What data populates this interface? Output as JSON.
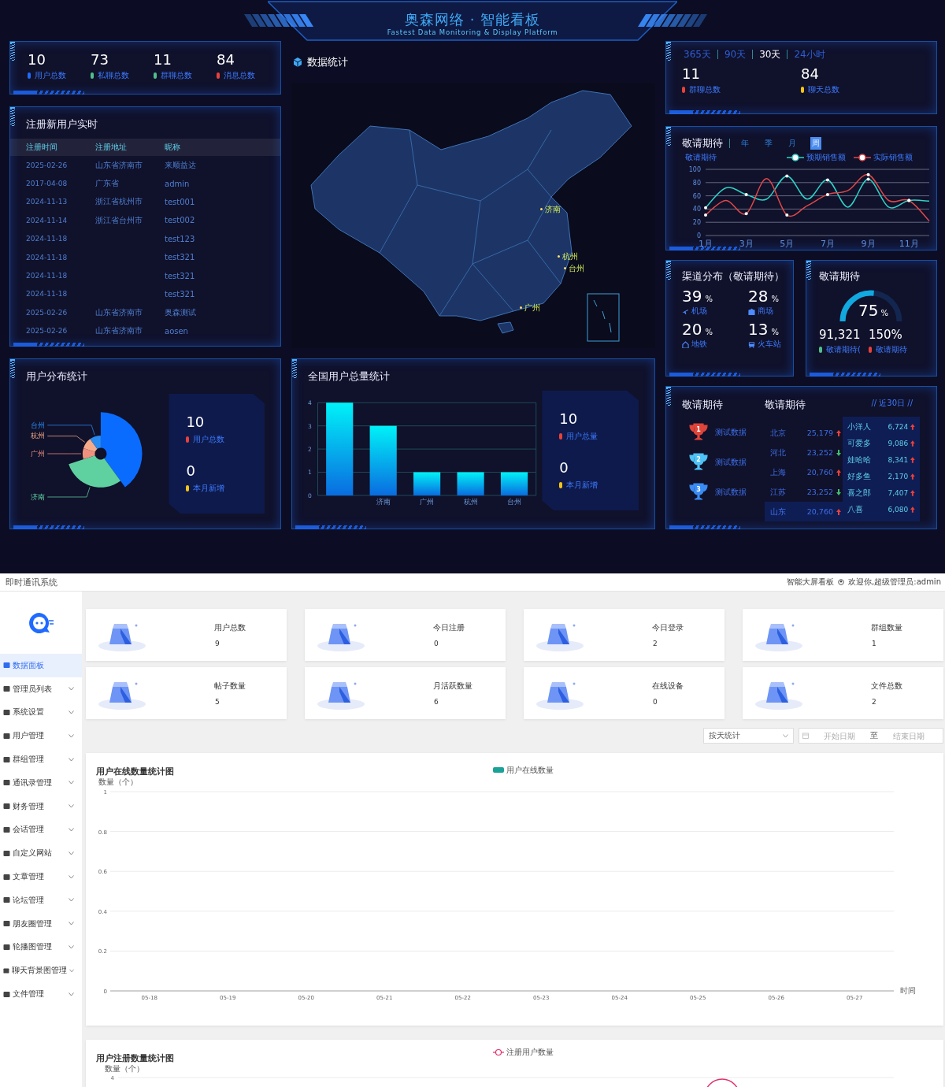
{
  "header": {
    "title": "奥森网络 · 智能看板",
    "subtitle": "Fastest Data Monitoring & Display Platform"
  },
  "totals": [
    {
      "value": "10",
      "label": "用户总数",
      "color": "#1e6cff"
    },
    {
      "value": "73",
      "label": "私聊总数",
      "color": "#4fc08d"
    },
    {
      "value": "11",
      "label": "群聊总数",
      "color": "#4fc08d"
    },
    {
      "value": "84",
      "label": "消息总数",
      "color": "#e8413c"
    }
  ],
  "new_users": {
    "title": "注册新用户实时",
    "columns": [
      "注册时间",
      "注册地址",
      "昵称"
    ],
    "rows": [
      {
        "date": "2025-02-26",
        "address": "山东省济南市",
        "nickname": "来顺益达"
      },
      {
        "date": "2017-04-08",
        "address": "广东省",
        "nickname": "admin"
      },
      {
        "date": "2024-11-13",
        "address": "浙江省杭州市",
        "nickname": "test001"
      },
      {
        "date": "2024-11-14",
        "address": "浙江省台州市",
        "nickname": "test002"
      },
      {
        "date": "2024-11-18",
        "nickname": "test123"
      },
      {
        "date": "2024-11-18",
        "nickname": "test321"
      },
      {
        "date": "2024-11-18",
        "nickname": "test321"
      },
      {
        "date": "2024-11-18",
        "nickname": "test321"
      },
      {
        "date": "2025-02-26",
        "address": "山东省济南市",
        "nickname": "奥森测试"
      },
      {
        "date": "2025-02-26",
        "address": "山东省济南市",
        "nickname": "aosen"
      }
    ]
  },
  "user_distribution": {
    "title": "用户分布统计",
    "slice_labels": [
      "台州",
      "杭州",
      "广州",
      "济南"
    ],
    "stats": [
      {
        "value": "10",
        "label": "用户总数",
        "color": "#e8413c"
      },
      {
        "value": "0",
        "label": "本月新增",
        "color": "#f5c518"
      }
    ]
  },
  "map": {
    "heading": "数据统计",
    "labels": [
      "济南",
      "杭州",
      "台州",
      "广州"
    ]
  },
  "user_totals": {
    "title": "全国用户总量统计",
    "chart_data": {
      "type": "bar",
      "categories": [
        null,
        "济南",
        "广州",
        "杭州",
        "台州"
      ],
      "values": [
        4,
        3,
        1,
        1,
        1
      ],
      "ylim": [
        0,
        4
      ],
      "yticks": [
        0,
        1,
        2,
        3,
        4
      ],
      "grid": true
    },
    "stats": [
      {
        "value": "10",
        "label": "用户总量",
        "color": "#e8413c"
      },
      {
        "value": "0",
        "label": "本月新增",
        "color": "#f5c518"
      }
    ]
  },
  "range": {
    "tabs": [
      {
        "label": "365天",
        "selected": false
      },
      {
        "label": "90天",
        "selected": false
      },
      {
        "label": "30天",
        "selected": true
      },
      {
        "label": "24小时",
        "selected": false
      }
    ],
    "stats": [
      {
        "value": "11",
        "label": "群聊总数",
        "color": "#e8413c"
      },
      {
        "value": "84",
        "label": "聊天总数",
        "color": "#f5c518"
      }
    ]
  },
  "trend": {
    "title": "敬请期待",
    "tabs": [
      {
        "label": "年",
        "selected": false
      },
      {
        "label": "季",
        "selected": false
      },
      {
        "label": "月",
        "selected": false
      },
      {
        "label": "周",
        "selected": true
      }
    ],
    "chart_data": {
      "type": "line",
      "grid": true,
      "ylabel": "敬请期待",
      "x": [
        1,
        2,
        3,
        4,
        5,
        6,
        7,
        8,
        9,
        10,
        11,
        12
      ],
      "xlim": [
        1,
        12
      ],
      "ylim": [
        0,
        100
      ],
      "yticks": [
        0,
        20,
        40,
        60,
        80,
        100
      ],
      "xticks": [
        {
          "value": 1,
          "label": "1月"
        },
        {
          "value": 3,
          "label": "3月"
        },
        {
          "value": 5,
          "label": "5月"
        },
        {
          "value": 7,
          "label": "7月"
        },
        {
          "value": 9,
          "label": "9月"
        },
        {
          "value": 11,
          "label": "11月"
        }
      ],
      "series": [
        {
          "name": "预期销售额",
          "color": "#2ed3c6",
          "values": [
            42,
            72,
            62,
            55,
            90,
            55,
            84,
            43,
            85,
            43,
            53,
            52
          ]
        },
        {
          "name": "实际销售额",
          "color": "#e04848",
          "values": [
            31,
            53,
            33,
            86,
            31,
            45,
            62,
            68,
            92,
            53,
            53,
            22
          ]
        }
      ]
    }
  },
  "channels": {
    "title": "渠道分布（敬请期待）",
    "items": [
      {
        "value": "39",
        "unit": "%",
        "label": "机场",
        "kind": "plane"
      },
      {
        "value": "28",
        "unit": "%",
        "label": "商场",
        "kind": "shop"
      },
      {
        "value": "20",
        "unit": "%",
        "label": "地铁",
        "kind": "metro"
      },
      {
        "value": "13",
        "unit": "%",
        "label": "火车站",
        "kind": "train"
      }
    ]
  },
  "gauge": {
    "title": "敬请期待",
    "level": 0.55,
    "value": "75",
    "unit": "%",
    "stats": [
      {
        "value": "91,321",
        "label": "敬请期待(",
        "color": "#4fc08d"
      },
      {
        "value": "150%",
        "label": "敬请期待",
        "color": "#e8413c"
      }
    ]
  },
  "ranking": {
    "trophy_title": "敬请期待",
    "trophies": [
      {
        "rank": "1",
        "label": "测试数据",
        "color": "#e0453a"
      },
      {
        "rank": "2",
        "label": "测试数据",
        "color": "#4fc3f7"
      },
      {
        "rank": "3",
        "label": "测试数据",
        "color": "#3a8df5"
      }
    ],
    "list_title": "敬请期待",
    "period": "// 近30日 //",
    "provinces": [
      {
        "name": "北京",
        "value": "25,179",
        "kind": "up",
        "selected": false
      },
      {
        "name": "河北",
        "value": "23,252",
        "kind": "down",
        "selected": false
      },
      {
        "name": "上海",
        "value": "20,760",
        "kind": "up",
        "selected": false
      },
      {
        "name": "江苏",
        "value": "23,252",
        "kind": "down",
        "selected": false
      },
      {
        "name": "山东",
        "value": "20,760",
        "kind": "up",
        "selected": true
      }
    ],
    "brands": [
      {
        "name": "小洋人",
        "value": "6,724",
        "kind": "up"
      },
      {
        "name": "可爱多",
        "value": "9,086",
        "kind": "up"
      },
      {
        "name": "娃哈哈",
        "value": "8,341",
        "kind": "up"
      },
      {
        "name": "好多鱼",
        "value": "2,170",
        "kind": "up"
      },
      {
        "name": "喜之郎",
        "value": "7,407",
        "kind": "up"
      },
      {
        "name": "八喜",
        "value": "6,080",
        "kind": "up"
      }
    ]
  },
  "admin": {
    "app_title": "即时通讯系统",
    "top_link": "智能大屏看板",
    "welcome": "欢迎你,超级管理员:admin",
    "menu": [
      {
        "label": "数据面板",
        "selected": true,
        "expandable": false
      },
      {
        "label": "管理员列表",
        "selected": false,
        "expandable": true
      },
      {
        "label": "系统设置",
        "selected": false,
        "expandable": true
      },
      {
        "label": "用户管理",
        "selected": false,
        "expandable": true
      },
      {
        "label": "群组管理",
        "selected": false,
        "expandable": true
      },
      {
        "label": "通讯录管理",
        "selected": false,
        "expandable": true
      },
      {
        "label": "财务管理",
        "selected": false,
        "expandable": true
      },
      {
        "label": "会话管理",
        "selected": false,
        "expandable": true
      },
      {
        "label": "自定义网站",
        "selected": false,
        "expandable": true
      },
      {
        "label": "文章管理",
        "selected": false,
        "expandable": true
      },
      {
        "label": "论坛管理",
        "selected": false,
        "expandable": true
      },
      {
        "label": "朋友圈管理",
        "selected": false,
        "expandable": true
      },
      {
        "label": "轮播图管理",
        "selected": false,
        "expandable": true
      },
      {
        "label": "聊天背景图管理",
        "selected": false,
        "expandable": true
      },
      {
        "label": "文件管理",
        "selected": false,
        "expandable": true
      }
    ],
    "cards": [
      {
        "label": "用户总数",
        "value": "9"
      },
      {
        "label": "今日注册",
        "value": "0"
      },
      {
        "label": "今日登录",
        "value": "2"
      },
      {
        "label": "群组数量",
        "value": "1"
      },
      {
        "label": "帖子数量",
        "value": "5"
      },
      {
        "label": "月活跃数量",
        "value": "6"
      },
      {
        "label": "在线设备",
        "value": "0"
      },
      {
        "label": "文件总数",
        "value": "2"
      }
    ],
    "filters": {
      "group_by": "按天统计",
      "start_placeholder": "开始日期",
      "separator": "至",
      "end_placeholder": "结束日期"
    },
    "online_chart": {
      "title": "用户在线数量统计图",
      "chart_data": {
        "type": "bar",
        "ylabel": "数量（个）",
        "xlabel": "时间",
        "categories": [
          "05-18",
          "05-19",
          "05-20",
          "05-21",
          "05-22",
          "05-23",
          "05-24",
          "05-25",
          "05-26",
          "05-27"
        ],
        "series": [
          {
            "name": "用户在线数量",
            "color": "#1aa198",
            "values": [
              0,
              0,
              0,
              0,
              0,
              0,
              0,
              0,
              0,
              0
            ]
          }
        ],
        "ylim": [
          0,
          1
        ],
        "yticks": [
          0,
          0.2,
          0.4,
          0.6,
          0.8,
          1
        ],
        "grid": true
      }
    },
    "register_chart": {
      "title": "用户注册数量统计图",
      "legend": "注册用户数量",
      "ylabel": "数量（个）",
      "top_tick": "4"
    }
  }
}
